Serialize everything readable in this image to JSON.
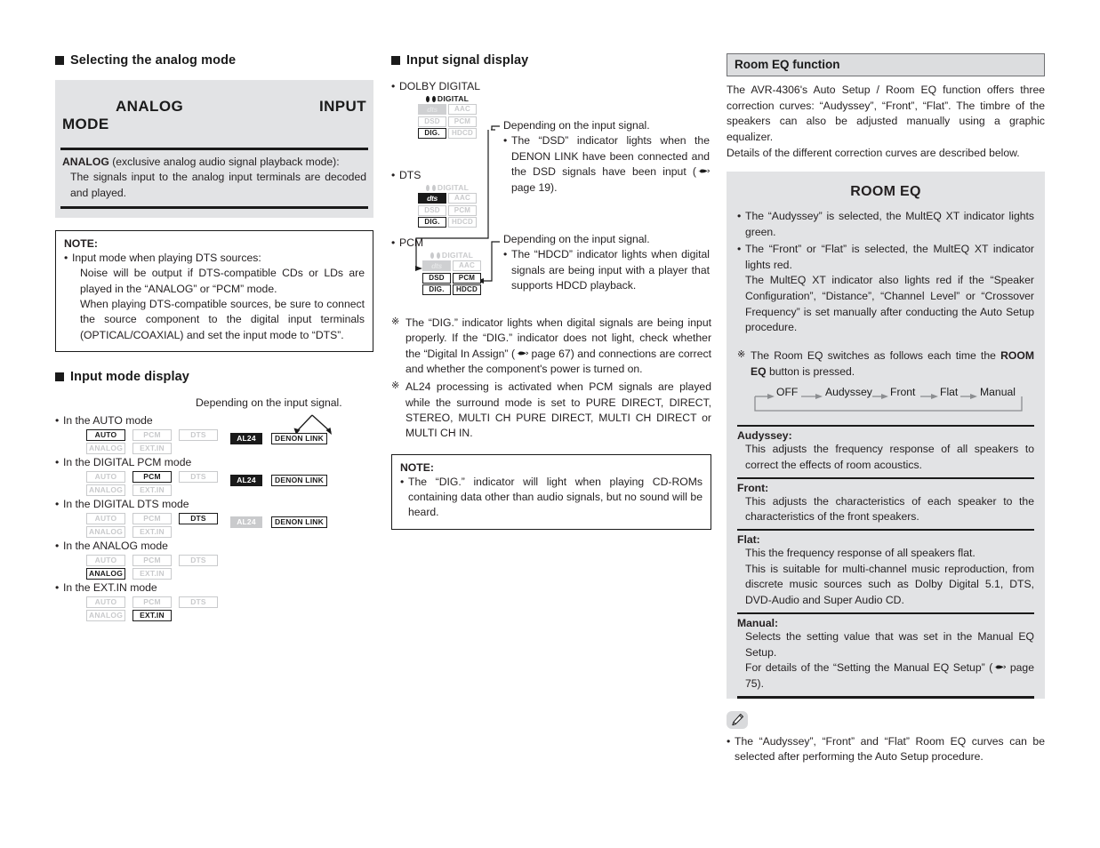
{
  "left": {
    "heading_analog_mode": "Selecting the analog mode",
    "banner": {
      "analog": "ANALOG",
      "input": "INPUT",
      "mode": "MODE"
    },
    "analog_desc_lead": "ANALOG",
    "analog_desc_rest": " (exclusive analog audio signal playback mode):",
    "analog_desc_body": "The signals input to the analog input terminals are decoded and played.",
    "note": {
      "title": "NOTE:",
      "item": "Input mode when playing DTS sources:",
      "body1": "Noise will be output if DTS-compatible CDs or LDs are played in the “ANALOG” or “PCM” mode.",
      "body2": "When playing DTS-compatible sources, be sure to connect the source component to the digital input terminals (OPTICAL/COAXIAL) and set the input mode to “DTS”."
    },
    "heading_input_mode": "Input mode display",
    "depending_label": "Depending on the input signal.",
    "chips": {
      "auto": "AUTO",
      "pcm": "PCM",
      "dts": "DTS",
      "analog": "ANALOG",
      "extin": "EXT.IN",
      "al24": "AL24",
      "denonlink": "DENON LINK"
    },
    "modes": [
      {
        "label": "In the AUTO mode",
        "active": "auto",
        "al24": "fill",
        "dlink": "on"
      },
      {
        "label": "In the DIGITAL PCM mode",
        "active": "pcm",
        "al24": "fill",
        "dlink": "on"
      },
      {
        "label": "In the DIGITAL DTS mode",
        "active": "dts",
        "al24": "off",
        "dlink": "on"
      },
      {
        "label": "In the ANALOG mode",
        "active": "analog",
        "al24": "none",
        "dlink": "none"
      },
      {
        "label": "In the EXT.IN mode",
        "active": "extin",
        "al24": "none",
        "dlink": "none"
      }
    ]
  },
  "mid": {
    "heading": "Input signal display",
    "labels": {
      "dolby": "DOLBY DIGITAL",
      "dts": "DTS",
      "pcm": "PCM"
    },
    "chip_names": {
      "digital": "DIGITAL",
      "dts": "dts",
      "aac": "AAC",
      "dsd": "DSD",
      "pcm": "PCM",
      "dig": "DIG.",
      "hdcd": "HDCD"
    },
    "callout1": {
      "title": "Depending on the input signal.",
      "body": "The “DSD” indicator lights when the DENON LINK have been connected and the DSD signals have been input (",
      "page": "page 19)."
    },
    "callout2": {
      "title": "Depending on the input signal.",
      "body": "The “HDCD” indicator lights when digital signals are being input with a player that supports HDCD playback."
    },
    "star1_a": "The “DIG.” indicator lights when digital signals are being input properly. If the “DIG.” indicator does not light, check whether the “Digital In Assign” (",
    "star1_b": "page 67) and connections are correct and whether the component's power is turned on.",
    "star2": "AL24 processing is activated when PCM signals are played while the surround mode is set to PURE DIRECT, DIRECT, STEREO, MULTI CH PURE DIRECT, MULTI CH DIRECT or MULTI CH IN.",
    "note": {
      "title": "NOTE:",
      "body": "The “DIG.” indicator will light when playing CD-ROMs containing data other than audio signals, but no sound will be heard."
    }
  },
  "right": {
    "title_bar": "Room EQ function",
    "intro1": "The AVR-4306's Auto Setup / Room EQ function offers three correction curves: “Audyssey”, “Front”, “Flat”. The timbre of the speakers can also be adjusted manually using a graphic equalizer.",
    "intro2": "Details of the different correction curves are described below.",
    "room_eq_head": "ROOM EQ",
    "bullet1": "The “Audyssey” is selected, the MultEQ XT indicator lights green.",
    "bullet2": "The “Front” or “Flat” is selected, the MultEQ XT indicator lights red.",
    "bullet2_cont": "The MultEQ XT indicator also lights red if the “Speaker Configuration”, “Distance”, “Channel Level” or “Crossover Frequency” is set manually after conducting the Auto Setup procedure.",
    "star_a": "The Room EQ switches as follows each time the ",
    "star_b": "ROOM EQ",
    "star_c": " button is pressed.",
    "cycle": [
      "OFF",
      "Audyssey",
      "Front",
      "Flat",
      "Manual"
    ],
    "defs": [
      {
        "term": "Audyssey:",
        "body": "This adjusts the frequency response of all speakers to correct the effects of room acoustics."
      },
      {
        "term": "Front:",
        "body": "This adjusts the characteristics of each speaker to the characteristics of the front speakers."
      },
      {
        "term": "Flat:",
        "body": "This the frequency response of all speakers flat."
      },
      {
        "term": "",
        "body": "This is suitable for multi-channel music reproduction, from discrete music sources such as Dolby Digital 5.1, DTS, DVD-Audio and Super Audio CD."
      },
      {
        "term": "Manual:",
        "body": "Selects the setting value that was set in the Manual EQ Setup."
      },
      {
        "term": "",
        "body": "For details of the “Setting the Manual EQ Setup” ("
      }
    ],
    "manual_page": "page 75).",
    "tip": "The “Audyssey”, “Front” and “Flat” Room EQ curves can be selected after performing the Auto Setup procedure."
  },
  "colors": {
    "gray_panel": "#e2e3e5",
    "chip_off": "#c9cacc",
    "ink": "#1a1a1a"
  }
}
